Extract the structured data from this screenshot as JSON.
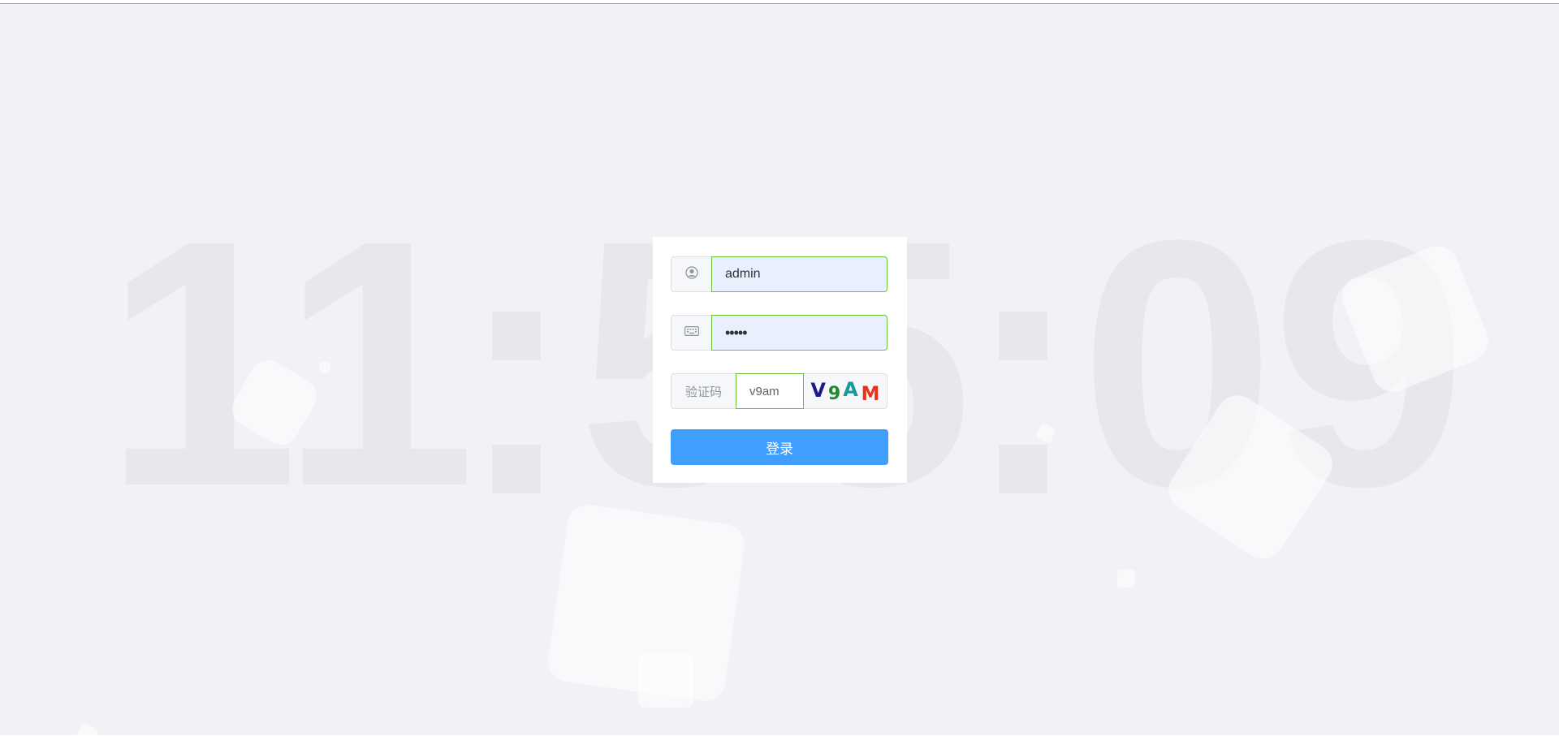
{
  "clock": {
    "h1": "1",
    "h2": "1",
    "m1": "5",
    "m2": "5",
    "s1": "0",
    "s2": "9"
  },
  "login": {
    "username_value": "admin",
    "password_value": "•••••",
    "captcha_label": "验证码",
    "captcha_value": "v9am",
    "captcha_chars": [
      "V",
      "9",
      "A",
      "M"
    ],
    "captcha_colors": [
      "#1a1a8c",
      "#1e8a2e",
      "#17989a",
      "#e8321a"
    ],
    "submit_label": "登录",
    "accent_color": "#409eff",
    "valid_border_color": "#67c23a"
  },
  "icons": {
    "username": "user-circle-icon",
    "password": "keyboard-icon"
  }
}
